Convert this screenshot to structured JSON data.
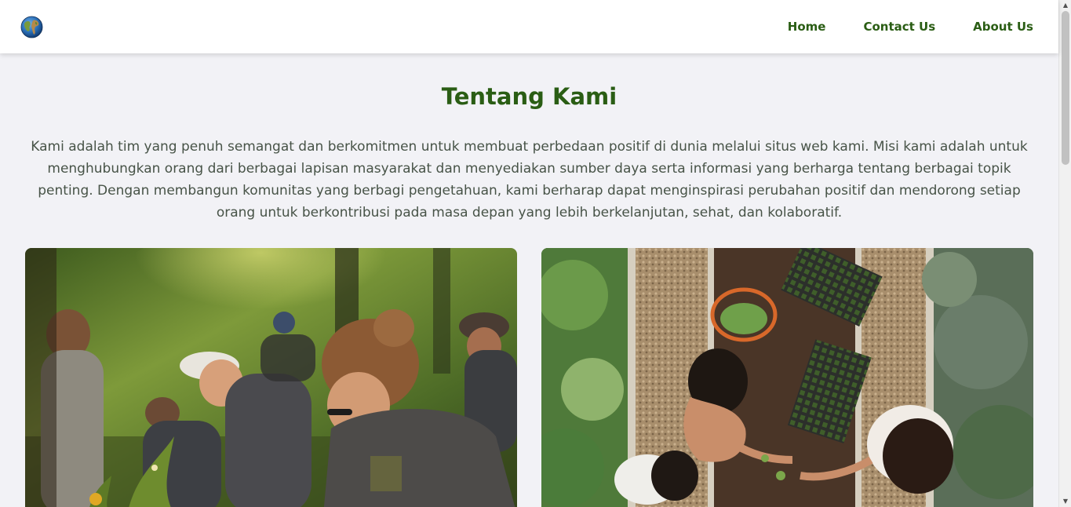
{
  "nav": {
    "logo_icon": "globe-icon",
    "links": [
      "Home",
      "Contact Us",
      "About Us"
    ]
  },
  "about": {
    "title": "Tentang Kami",
    "text": "Kami adalah tim yang penuh semangat dan berkomitmen untuk membuat perbedaan positif di dunia melalui situs web kami. Misi kami adalah untuk menghubungkan orang dari berbagai lapisan masyarakat dan menyediakan sumber daya serta informasi yang berharga tentang berbagai topik penting. Dengan membangun komunitas yang berbagi pengetahuan, kami berharap dapat menginspirasi perubahan positif dan mendorong setiap orang untuk berkontribusi pada masa depan yang lebih berkelanjutan, sehat, dan kolaboratif."
  },
  "colors": {
    "accent": "#2a5d14",
    "background": "#f2f2f6",
    "text": "#475347"
  }
}
